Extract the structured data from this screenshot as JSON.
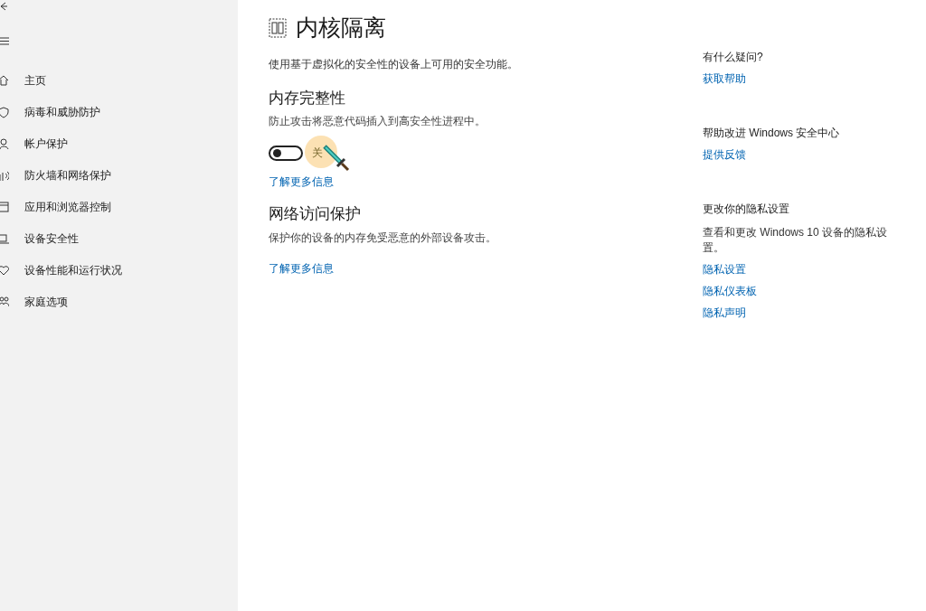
{
  "sidebar": {
    "items": [
      {
        "label": "主页",
        "selected": false
      },
      {
        "label": "病毒和威胁防护",
        "selected": false
      },
      {
        "label": "帐户保护",
        "selected": false
      },
      {
        "label": "防火墙和网络保护",
        "selected": false
      },
      {
        "label": "应用和浏览器控制",
        "selected": false
      },
      {
        "label": "设备安全性",
        "selected": false
      },
      {
        "label": "设备性能和运行状况",
        "selected": false
      },
      {
        "label": "家庭选项",
        "selected": false
      }
    ]
  },
  "page": {
    "title": "内核隔离",
    "description": "使用基于虚拟化的安全性的设备上可用的安全功能。",
    "sections": [
      {
        "heading": "内存完整性",
        "description": "防止攻击将恶意代码插入到高安全性进程中。",
        "toggle": {
          "on": false,
          "label": "关"
        },
        "link": "了解更多信息"
      },
      {
        "heading": "网络访问保护",
        "description": "保护你的设备的内存免受恶意的外部设备攻击。",
        "link": "了解更多信息"
      }
    ]
  },
  "aside": [
    {
      "heading": "有什么疑问?",
      "links": [
        "获取帮助"
      ]
    },
    {
      "heading": "帮助改进 Windows 安全中心",
      "links": [
        "提供反馈"
      ]
    },
    {
      "heading": "更改你的隐私设置",
      "description": "查看和更改 Windows 10 设备的隐私设置。",
      "links": [
        "隐私设置",
        "隐私仪表板",
        "隐私声明"
      ]
    }
  ]
}
